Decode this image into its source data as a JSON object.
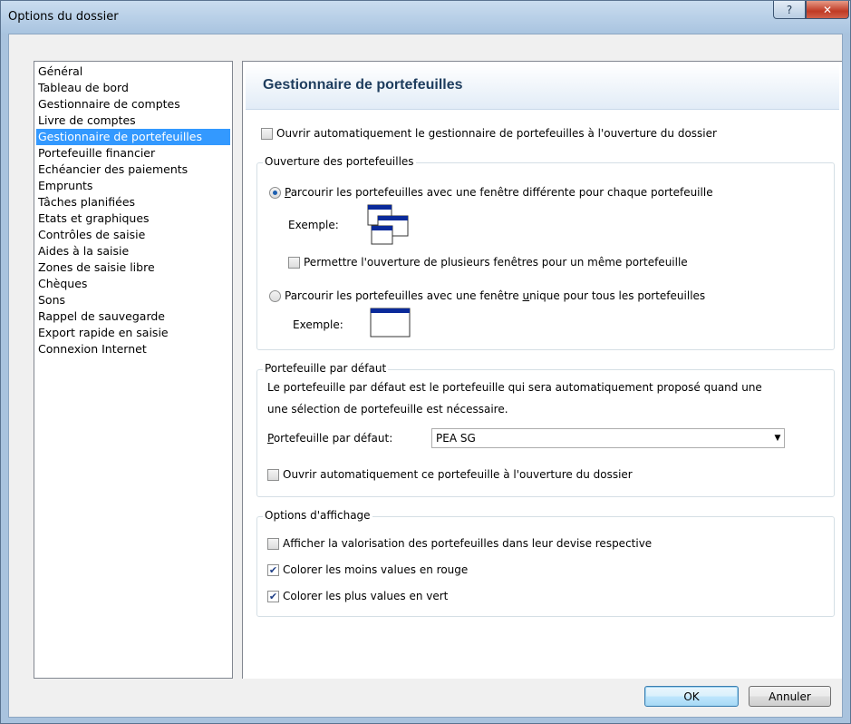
{
  "window": {
    "title": "Options du dossier",
    "help_symbol": "?",
    "close_symbol": "✕"
  },
  "sidebar": {
    "items": [
      {
        "label": "Général"
      },
      {
        "label": "Tableau de bord"
      },
      {
        "label": "Gestionnaire de comptes"
      },
      {
        "label": "Livre de comptes"
      },
      {
        "label": "Gestionnaire de portefeuilles",
        "selected": true
      },
      {
        "label": "Portefeuille financier"
      },
      {
        "label": "Echéancier des paiements"
      },
      {
        "label": "Emprunts"
      },
      {
        "label": "Tâches planifiées"
      },
      {
        "label": "Etats et graphiques"
      },
      {
        "label": "Contrôles de saisie"
      },
      {
        "label": "Aides à la saisie"
      },
      {
        "label": "Zones de saisie libre"
      },
      {
        "label": "Chèques"
      },
      {
        "label": "Sons"
      },
      {
        "label": "Rappel de sauvegarde"
      },
      {
        "label": "Export rapide en saisie"
      },
      {
        "label": "Connexion Internet"
      }
    ]
  },
  "panel": {
    "title": "Gestionnaire de portefeuilles",
    "auto_open_manager": {
      "label": "Ouvrir automatiquement le gestionnaire de portefeuilles à l'ouverture du dossier",
      "checked": false
    },
    "opening_group": {
      "legend": "Ouverture des portefeuilles",
      "option_multi": {
        "label_mnemonic": "P",
        "label_rest": "arcourir les portefeuilles avec une fenêtre différente pour chaque portefeuille",
        "selected": true
      },
      "example_label_1": "Exemple:",
      "allow_multiple": {
        "label": "Permettre l'ouverture de plusieurs fenêtres pour un même portefeuille",
        "checked": false
      },
      "option_single": {
        "label_before": "Parcourir les portefeuilles avec une fenêtre ",
        "label_mnemonic": "u",
        "label_after": "nique pour tous les portefeuilles",
        "selected": false
      },
      "example_label_2": "Exemple:"
    },
    "default_group": {
      "legend": "Portefeuille par défaut",
      "description_line1": "Le portefeuille par défaut est le portefeuille qui sera automatiquement proposé quand une",
      "description_line2": "une sélection de portefeuille est nécessaire.",
      "select_label_mnemonic": "P",
      "select_label_rest": "ortefeuille par défaut:",
      "select_value": "PEA SG",
      "auto_open_default": {
        "label": "Ouvrir automatiquement ce portefeuille à l'ouverture du dossier",
        "checked": false
      }
    },
    "display_group": {
      "legend": "Options d'affichage",
      "show_currency": {
        "label": "Afficher la valorisation des portefeuilles dans leur devise respective",
        "checked": false
      },
      "red_losses": {
        "label": "Colorer les moins values en rouge",
        "checked": true
      },
      "green_gains": {
        "label": "Colorer les plus values en vert",
        "checked": true
      }
    }
  },
  "buttons": {
    "ok": "OK",
    "cancel": "Annuler"
  },
  "colors": {
    "selection": "#3399ff",
    "banner_title": "#1e3d5e",
    "close_button": "#c03a25"
  }
}
